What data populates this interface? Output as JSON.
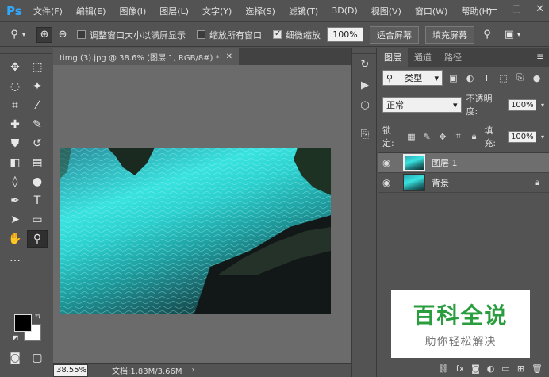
{
  "app": {
    "logo": "Ps",
    "brand_color": "#31a8ff"
  },
  "menu": [
    "文件(F)",
    "编辑(E)",
    "图像(I)",
    "图层(L)",
    "文字(Y)",
    "选择(S)",
    "滤镜(T)",
    "3D(D)",
    "视图(V)",
    "窗口(W)",
    "帮助(H)"
  ],
  "window_controls": {
    "minimize": "—",
    "restore": "▢",
    "close": "✕"
  },
  "options": {
    "resize_windows": "调整窗口大小以满屏显示",
    "zoom_all_windows": "缩放所有窗口",
    "scrubby_zoom": "细微缩放",
    "zoom_value": "100%",
    "fit_screen": "适合屏幕",
    "fill_screen": "填充屏幕"
  },
  "document": {
    "tab_title": "timg (3).jpg @ 38.6% (图层 1, RGB/8#) *",
    "zoom": "38.55%",
    "info": "文档:1.83M/3.66M"
  },
  "layers_panel": {
    "tabs": [
      "图层",
      "通道",
      "路径"
    ],
    "kind_filter": "类型",
    "blend_mode": "正常",
    "opacity_label": "不透明度:",
    "opacity_value": "100%",
    "lock_label": "锁定:",
    "fill_label": "填充:",
    "fill_value": "100%",
    "layers": [
      {
        "name": "图层 1",
        "selected": true,
        "locked": false
      },
      {
        "name": "背景",
        "selected": false,
        "locked": true
      }
    ]
  },
  "watermark": {
    "title": "百科全说",
    "subtitle": "助你轻松解决",
    "color": "#2a9d3f"
  }
}
